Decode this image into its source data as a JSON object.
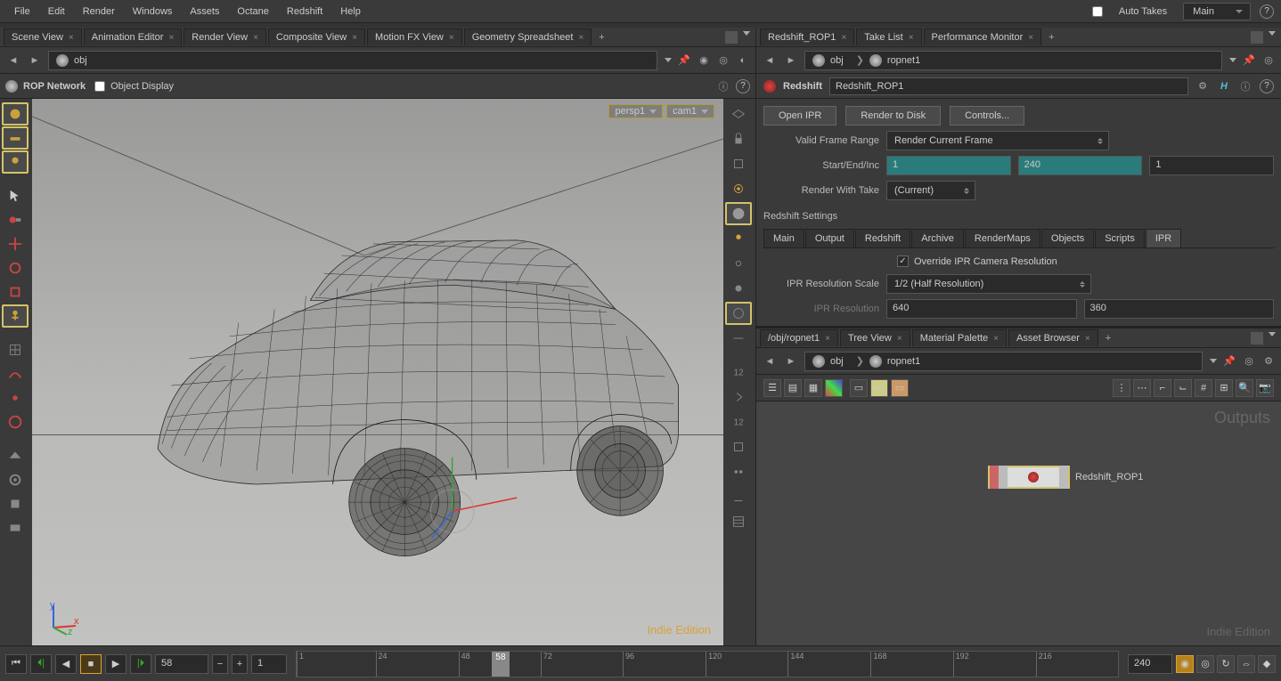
{
  "menubar": {
    "items": [
      "File",
      "Edit",
      "Render",
      "Windows",
      "Assets",
      "Octane",
      "Redshift",
      "Help"
    ],
    "auto_takes": "Auto Takes",
    "main": "Main"
  },
  "left_tabs": [
    "Scene View",
    "Animation Editor",
    "Render View",
    "Composite View",
    "Motion FX View",
    "Geometry Spreadsheet"
  ],
  "right_tabs": [
    "Redshift_ROP1",
    "Take List",
    "Performance Monitor"
  ],
  "left_path": {
    "context": "obj"
  },
  "right_path": {
    "context": "obj",
    "node": "ropnet1"
  },
  "viewer_header": {
    "label1": "ROP Network",
    "label2": "Object Display"
  },
  "cameras": {
    "persp": "persp1",
    "cam": "cam1"
  },
  "indie": "Indie Edition",
  "parm": {
    "type": "Redshift",
    "name": "Redshift_ROP1",
    "buttons": {
      "ipr": "Open IPR",
      "disk": "Render to Disk",
      "controls": "Controls..."
    },
    "frame_range": {
      "label": "Valid Frame Range",
      "value": "Render Current Frame"
    },
    "sei": {
      "label": "Start/End/Inc",
      "start": "1",
      "end": "240",
      "inc": "1"
    },
    "take": {
      "label": "Render With Take",
      "value": "(Current)"
    },
    "settings_title": "Redshift Settings",
    "tabs": [
      "Main",
      "Output",
      "Redshift",
      "Archive",
      "RenderMaps",
      "Objects",
      "Scripts",
      "IPR"
    ],
    "override": {
      "label": "Override IPR Camera Resolution"
    },
    "ipr_scale": {
      "label": "IPR Resolution Scale",
      "value": "1/2 (Half Resolution)"
    },
    "ipr_res": {
      "label": "IPR Resolution",
      "w": "640",
      "h": "360"
    }
  },
  "network_tabs": [
    "/obj/ropnet1",
    "Tree View",
    "Material Palette",
    "Asset Browser"
  ],
  "network_path": {
    "context": "obj",
    "node": "ropnet1"
  },
  "outputs_label": "Outputs",
  "node_name": "Redshift_ROP1",
  "timeline": {
    "current": "58",
    "start": "1",
    "end": "240",
    "ticks": [
      1,
      24,
      48,
      58,
      72,
      96,
      120,
      144,
      168,
      192,
      216
    ],
    "playhead": "58"
  }
}
